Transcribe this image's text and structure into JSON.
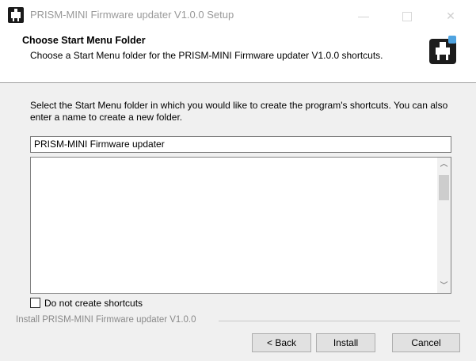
{
  "window": {
    "title": "PRISM-MINI Firmware updater V1.0.0 Setup",
    "minimize_icon": "minimize-icon",
    "maximize_icon": "maximize-icon",
    "close_icon": "close-icon"
  },
  "header": {
    "title": "Choose Start Menu Folder",
    "subtitle": "Choose a Start Menu folder for the PRISM-MINI Firmware updater V1.0.0 shortcuts.",
    "logo_icon": "installer-logo-icon"
  },
  "main": {
    "description": "Select the Start Menu folder in which you would like to create the program's shortcuts. You can also enter a name to create a new folder.",
    "folder_input_value": "PRISM-MINI Firmware updater",
    "folder_list_items": [],
    "checkbox_label": "Do not create shortcuts",
    "checkbox_checked": false
  },
  "footer": {
    "branding": "Install PRISM-MINI Firmware updater V1.0.0",
    "back_label": "< Back",
    "install_label": "Install",
    "cancel_label": "Cancel"
  },
  "colors": {
    "dialog_background": "#f0f0f0",
    "header_background": "#ffffff",
    "button_background": "#e1e1e1",
    "title_text": "#999999"
  }
}
